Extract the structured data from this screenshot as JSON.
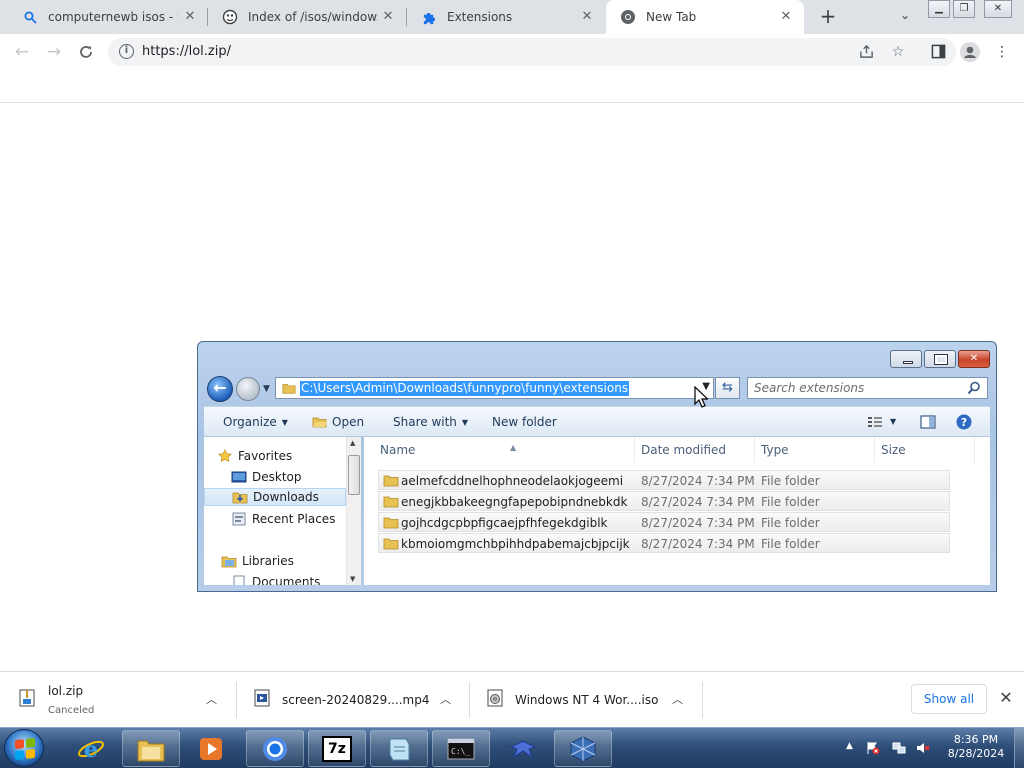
{
  "browser": {
    "tabs": [
      {
        "title": "computernewb isos - Sea",
        "icon": "search-icon"
      },
      {
        "title": "Index of /isos/windows/",
        "icon": "globe-icon"
      },
      {
        "title": "Extensions",
        "icon": "puzzle-icon"
      },
      {
        "title": "New Tab",
        "icon": "chrome-icon",
        "active": true
      }
    ],
    "url": "https://lol.zip/"
  },
  "explorer": {
    "address_path": "C:\\Users\\Admin\\Downloads\\funnypro\\funny\\extensions",
    "search_placeholder": "Search extensions",
    "commands": {
      "organize": "Organize",
      "open": "Open",
      "share_with": "Share with",
      "new_folder": "New folder"
    },
    "nav": {
      "favorites": "Favorites",
      "desktop": "Desktop",
      "downloads": "Downloads",
      "recent_places": "Recent Places",
      "libraries": "Libraries",
      "documents": "Documents"
    },
    "columns": {
      "name": "Name",
      "date_modified": "Date modified",
      "type": "Type",
      "size": "Size"
    },
    "files": [
      {
        "name": "aelmefcddnelhophneodelaokjogeemi",
        "date": "8/27/2024 7:34 PM",
        "type": "File folder"
      },
      {
        "name": "enegjkbbakeegngfapepobipndnebkdk",
        "date": "8/27/2024 7:34 PM",
        "type": "File folder"
      },
      {
        "name": "gojhcdgcpbpfigcaejpfhfegekdgiblk",
        "date": "8/27/2024 7:34 PM",
        "type": "File folder"
      },
      {
        "name": "kbmoiomgmchbpihhdpabemajcbjpcijk",
        "date": "8/27/2024 7:34 PM",
        "type": "File folder"
      }
    ]
  },
  "downloads": {
    "items": [
      {
        "name": "lol.zip",
        "status": "Canceled",
        "icon": "zip-icon"
      },
      {
        "name": "screen-20240829....mp4",
        "icon": "video-file-icon"
      },
      {
        "name": "Windows NT 4 Wor....iso",
        "icon": "iso-file-icon"
      }
    ],
    "show_all": "Show all"
  },
  "taskbar": {
    "time": "8:36 PM",
    "date": "8/28/2024",
    "sevenzip_label": "7z"
  },
  "colors": {
    "chrome_tabstrip": "#dee1e6",
    "selection": "#3399ff",
    "link": "#1a73e8"
  }
}
